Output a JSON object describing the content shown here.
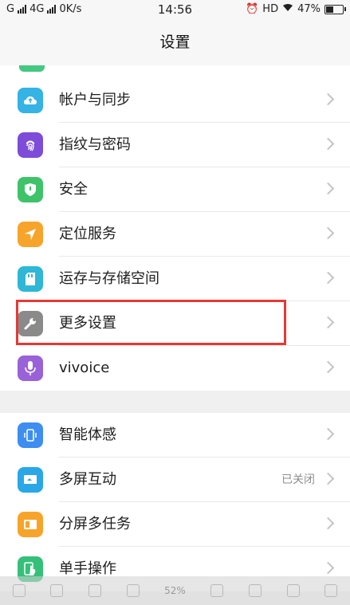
{
  "status_bar": {
    "carrier1": "G",
    "carrier2": "4G",
    "speed": "0K/s",
    "time": "14:56",
    "hd": "HD",
    "battery": "47%",
    "battery_level": 0.47
  },
  "header": {
    "title": "设置"
  },
  "group1": {
    "items": [
      {
        "label": "帐户与同步",
        "icon": "cloud-icon",
        "color": "#34b3e4"
      },
      {
        "label": "指纹与密码",
        "icon": "fingerprint-icon",
        "color": "#7d4cd8"
      },
      {
        "label": "安全",
        "icon": "shield-icon",
        "color": "#3fc36a"
      },
      {
        "label": "定位服务",
        "icon": "location-arrow-icon",
        "color": "#f7a42b"
      },
      {
        "label": "运存与存储空间",
        "icon": "sd-card-icon",
        "color": "#2eb7d6"
      },
      {
        "label": "更多设置",
        "icon": "wrench-icon",
        "color": "#8a8a8a"
      },
      {
        "label": "vivoice",
        "icon": "microphone-icon",
        "color": "#9a62d8"
      }
    ]
  },
  "group2": {
    "items": [
      {
        "label": "智能体感",
        "icon": "phone-gesture-icon",
        "color": "#3d8ef0",
        "value": ""
      },
      {
        "label": "多屏互动",
        "icon": "screen-cast-icon",
        "color": "#2aa7e6",
        "value": "已关闭"
      },
      {
        "label": "分屏多任务",
        "icon": "split-screen-icon",
        "color": "#f7a42b",
        "value": ""
      },
      {
        "label": "单手操作",
        "icon": "hand-icon",
        "color": "#35c07a",
        "value": ""
      }
    ]
  },
  "overlay": {
    "zoom": "52%"
  },
  "colors": {
    "highlight": "#e53935",
    "chevron": "#c4c4c4"
  }
}
